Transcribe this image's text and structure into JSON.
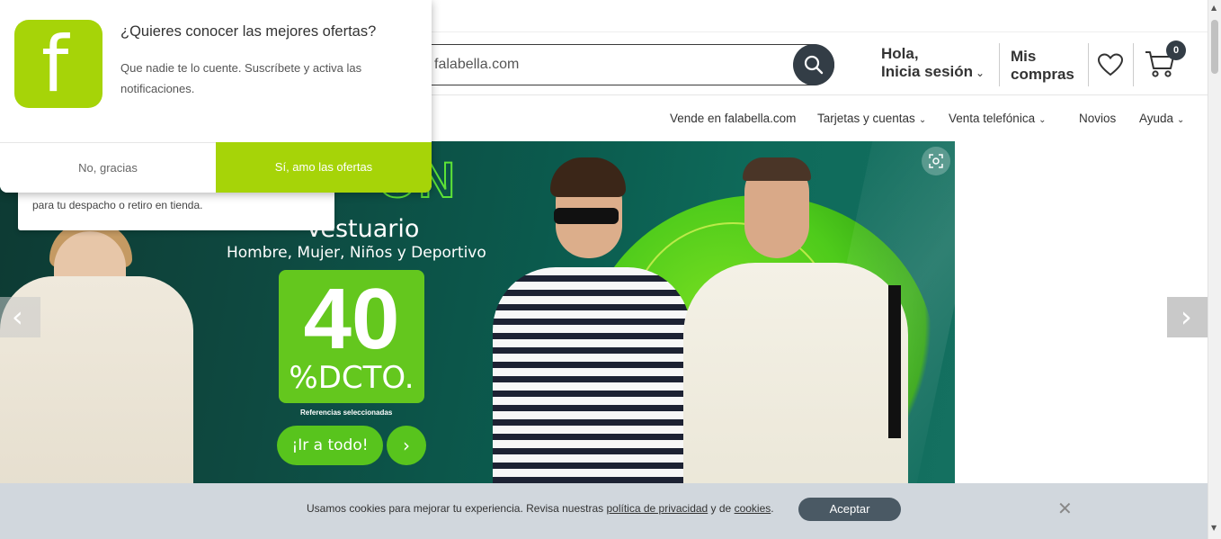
{
  "header": {
    "search_placeholder": "r en falabella.com",
    "login_greeting": "Hola,",
    "login_action": "Inicia sesión",
    "purchases_line1": "Mis",
    "purchases_line2": "compras",
    "cart_count": "0"
  },
  "subnav": {
    "items": [
      {
        "label": "Vende en falabella.com"
      },
      {
        "label": "Tarjetas y cuentas"
      },
      {
        "label": "Venta telefónica"
      },
      {
        "label": "Novios"
      },
      {
        "label": "Ayuda"
      }
    ]
  },
  "banner": {
    "headline_partial": "ON",
    "category": "Vestuario",
    "subtitle": "Hombre, Mujer, Niños y Deportivo",
    "discount_number": "40",
    "discount_label": "%DCTO.",
    "fine_print": "Referencias seleccionadas",
    "cta_label": "¡Ir a todo!",
    "cta_arrow": "›"
  },
  "carousel": {
    "prev_glyph": "‹",
    "next_glyph": "›"
  },
  "location_tip": {
    "line2": "para tu despacho o retiro en tienda."
  },
  "notification": {
    "logo_letter": "f",
    "title": "¿Quieres conocer las mejores ofertas?",
    "body": "Que nadie te lo cuente. Suscríbete y activa las notificaciones.",
    "decline_label": "No, gracias",
    "accept_label": "Sí, amo las ofertas"
  },
  "cookie": {
    "text_before": "Usamos cookies para mejorar tu experiencia. Revisa nuestras ",
    "privacy_link": "política de privacidad",
    "text_mid": " y de ",
    "cookies_link": "cookies",
    "text_end": ".",
    "accept_label": "Aceptar",
    "close_glyph": "✕"
  },
  "colors": {
    "brand_green": "#a6d408",
    "dark_slate": "#333d46",
    "promo_green": "#64c71e",
    "cookie_bg": "#d1d7dd"
  },
  "icons": [
    "search-icon",
    "chevron-down-icon",
    "heart-icon",
    "cart-icon",
    "camera-search-icon",
    "close-icon"
  ]
}
